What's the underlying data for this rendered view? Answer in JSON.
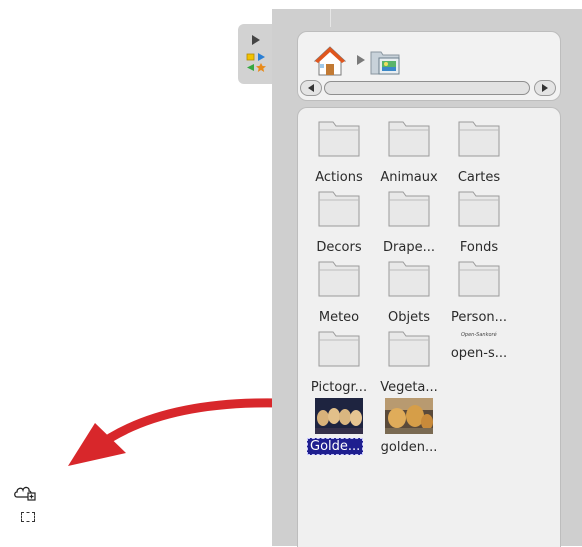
{
  "sidebar_handle": {
    "toggle_icon": "play-triangle-icon",
    "mode_icon": "shapes-icon"
  },
  "breadcrumb": {
    "home_icon": "home-icon",
    "separator_icon": "chevron-right-icon",
    "folder_icon": "image-folder-icon"
  },
  "scroll": {
    "left_icon": "arrow-left-icon",
    "right_icon": "arrow-right-icon"
  },
  "folders": [
    {
      "label": "Actions"
    },
    {
      "label": "Animaux"
    },
    {
      "label": "Cartes"
    },
    {
      "label": "Decors"
    },
    {
      "label": "Drape..."
    },
    {
      "label": "Fonds"
    },
    {
      "label": "Meteo"
    },
    {
      "label": "Objets"
    },
    {
      "label": "Person..."
    },
    {
      "label": "Pictogr..."
    },
    {
      "label": "Vegeta..."
    }
  ],
  "openSankore": {
    "label": "open-s...",
    "logo_text": "Open-Sankoré"
  },
  "images": [
    {
      "label": "Golde...",
      "selected": true
    },
    {
      "label": "golden...",
      "selected": false
    }
  ],
  "canvas": {
    "cursor_icon": "cloud-plus-cursor-icon",
    "drop_icon": "dashed-rectangle-icon",
    "arrow_color": "#d8272b"
  }
}
